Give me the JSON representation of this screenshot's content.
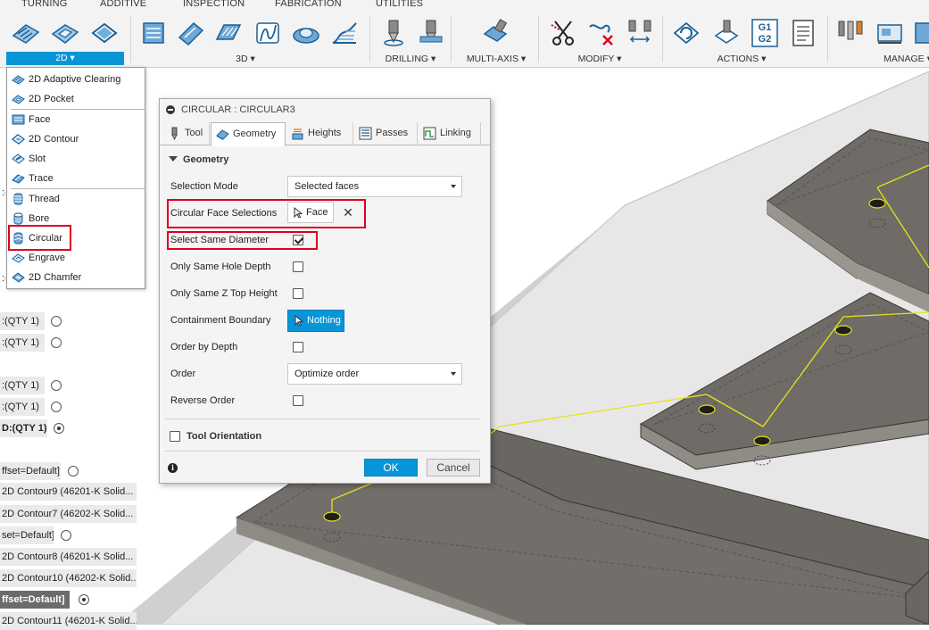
{
  "colors": {
    "accent": "#0696d7",
    "highlight_red": "#e0001b",
    "sketch_yellow": "#e6e21a",
    "part_gray": "#7a7570"
  },
  "toolbar": {
    "tabs": [
      "TURNING",
      "ADDITIVE",
      "INSPECTION",
      "FABRICATION",
      "UTILITIES"
    ],
    "groups": {
      "g2d": "2D",
      "g3d": "3D",
      "drilling": "DRILLING",
      "multiaxis": "MULTI-AXIS",
      "modify": "MODIFY",
      "actions": "ACTIONS",
      "manage": "MANAGE"
    },
    "g1g2_top": "G1",
    "g1g2_bottom": "G2"
  },
  "dropdown_2d": {
    "items": [
      "2D Adaptive Clearing",
      "2D Pocket",
      "Face",
      "2D Contour",
      "Slot",
      "Trace",
      "Thread",
      "Bore",
      "Circular",
      "Engrave",
      "2D Chamfer"
    ]
  },
  "browser_tree": {
    "partial_a": ":(",
    "partial_b": ":(",
    "rows": [
      ":(QTY 1)",
      ":(QTY 1)",
      ":(QTY 1)",
      ":(QTY 1)",
      "D:(QTY 1)",
      "ffset=Default]",
      "2D Contour9 (46201-K Solid...",
      "2D Contour7 (46202-K Solid...",
      "set=Default]",
      "2D Contour8 (46201-K Solid...",
      "2D Contour10 (46202-K Solid...",
      "ffset=Default]",
      "2D Contour11 (46201-K Solid..."
    ]
  },
  "dialog": {
    "title": "CIRCULAR : CIRCULAR3",
    "tabs": [
      "Tool",
      "Geometry",
      "Heights",
      "Passes",
      "Linking"
    ],
    "section_geometry": "Geometry",
    "selection_mode_label": "Selection Mode",
    "selection_mode_value": "Selected faces",
    "circular_face_label": "Circular Face Selections",
    "face_button": "Face",
    "clear_symbol": "✕",
    "same_diameter_label": "Select Same Diameter",
    "same_diameter_checked": true,
    "same_hole_depth_label": "Only Same Hole Depth",
    "same_z_top_label": "Only Same Z Top Height",
    "containment_label": "Containment Boundary",
    "containment_button": "Nothing",
    "order_by_depth_label": "Order by Depth",
    "order_label": "Order",
    "order_value": "Optimize order",
    "reverse_order_label": "Reverse Order",
    "tool_orientation_label": "Tool Orientation",
    "info": "i",
    "ok": "OK",
    "cancel": "Cancel"
  }
}
